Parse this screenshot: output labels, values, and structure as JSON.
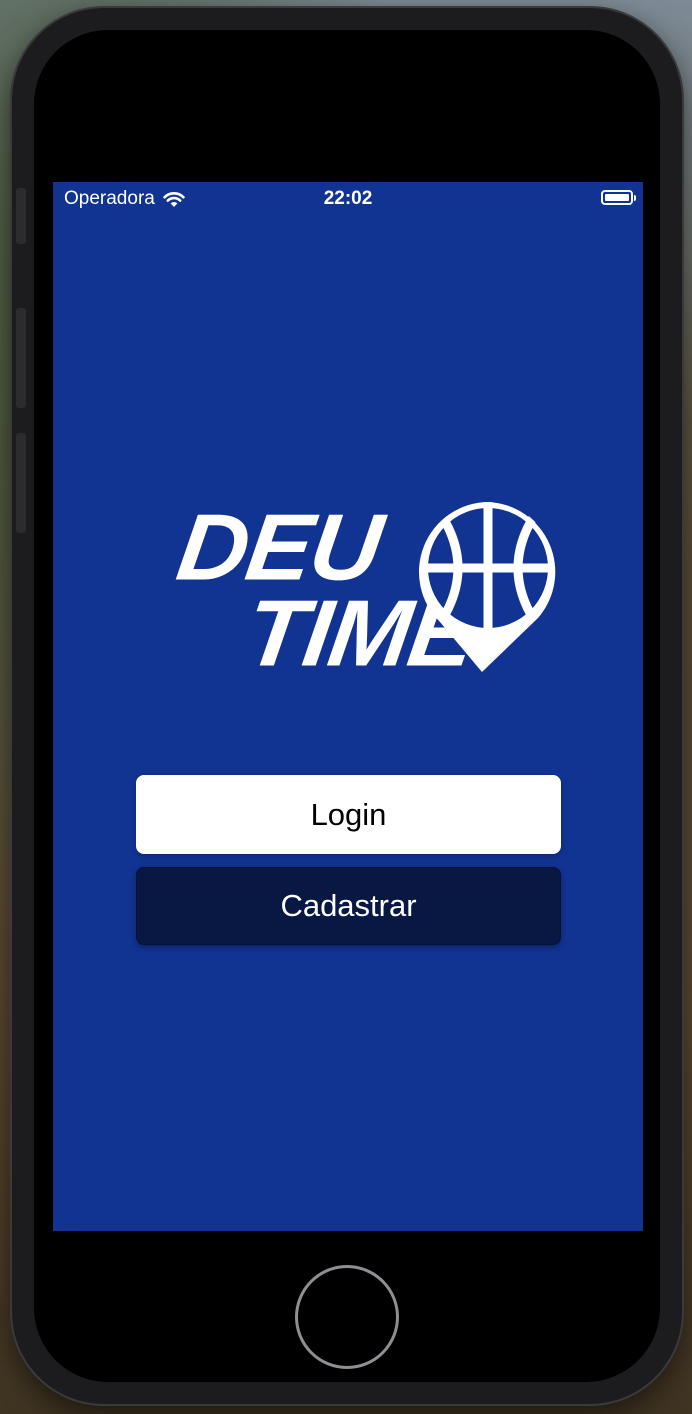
{
  "status_bar": {
    "carrier": "Operadora",
    "time": "22:02",
    "wifi_icon": "wifi-icon",
    "battery_icon": "battery-full-icon"
  },
  "logo": {
    "line1": "DEU",
    "line2": "TIME",
    "icon": "basketball-pin-icon"
  },
  "buttons": {
    "login_label": "Login",
    "register_label": "Cadastrar"
  },
  "colors": {
    "screen_background": "#113392",
    "register_button": "#081843",
    "login_button": "#ffffff"
  }
}
